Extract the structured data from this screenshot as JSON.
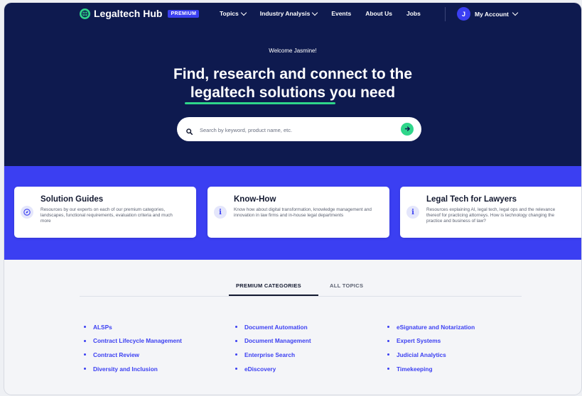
{
  "nav": {
    "brand": "Legaltech Hub",
    "badge": "PREMIUM",
    "links": [
      {
        "label": "Topics",
        "has_dropdown": true
      },
      {
        "label": "Industry Analysis",
        "has_dropdown": true
      },
      {
        "label": "Events",
        "has_dropdown": false
      },
      {
        "label": "About Us",
        "has_dropdown": false
      },
      {
        "label": "Jobs",
        "has_dropdown": false
      }
    ],
    "avatar_initial": "J",
    "account_label": "My Account"
  },
  "hero": {
    "welcome": "Welcome Jasmine!",
    "headline_line1": "Find, research and connect to the",
    "headline_line2": "legaltech solutions you need",
    "search_placeholder": "Search by keyword, product name, etc."
  },
  "cards": [
    {
      "title": "Solution Guides",
      "icon": "compass-icon",
      "description": "Resources by our experts on each of our premium categories, landscapes, functional requirements, evaluation criteria and much more"
    },
    {
      "title": "Know-How",
      "icon": "info-icon",
      "description": "Know how about digital transformation, knowledge management and innovation in law firms and in-house legal departments"
    },
    {
      "title": "Legal Tech for Lawyers",
      "icon": "info-icon",
      "description": "Resources explaining AI, legal tech, legal ops and the relevance thereof for practicing attorneys. How is technology changing the practice and business of law?"
    }
  ],
  "tabs": [
    {
      "label": "PREMIUM CATEGORIES",
      "active": true
    },
    {
      "label": "ALL TOPICS",
      "active": false
    }
  ],
  "categories": [
    [
      "ALSPs",
      "Contract Lifecycle Management",
      "Contract Review",
      "Diversity and Inclusion"
    ],
    [
      "Document Automation",
      "Document Management",
      "Enterprise Search",
      "eDiscovery"
    ],
    [
      "eSignature and Notarization",
      "Expert Systems",
      "Judicial Analytics",
      "Timekeeping"
    ]
  ],
  "colors": {
    "navy": "#0e1a4f",
    "brand_blue": "#3b3ff2",
    "accent_green": "#2fd68a"
  }
}
